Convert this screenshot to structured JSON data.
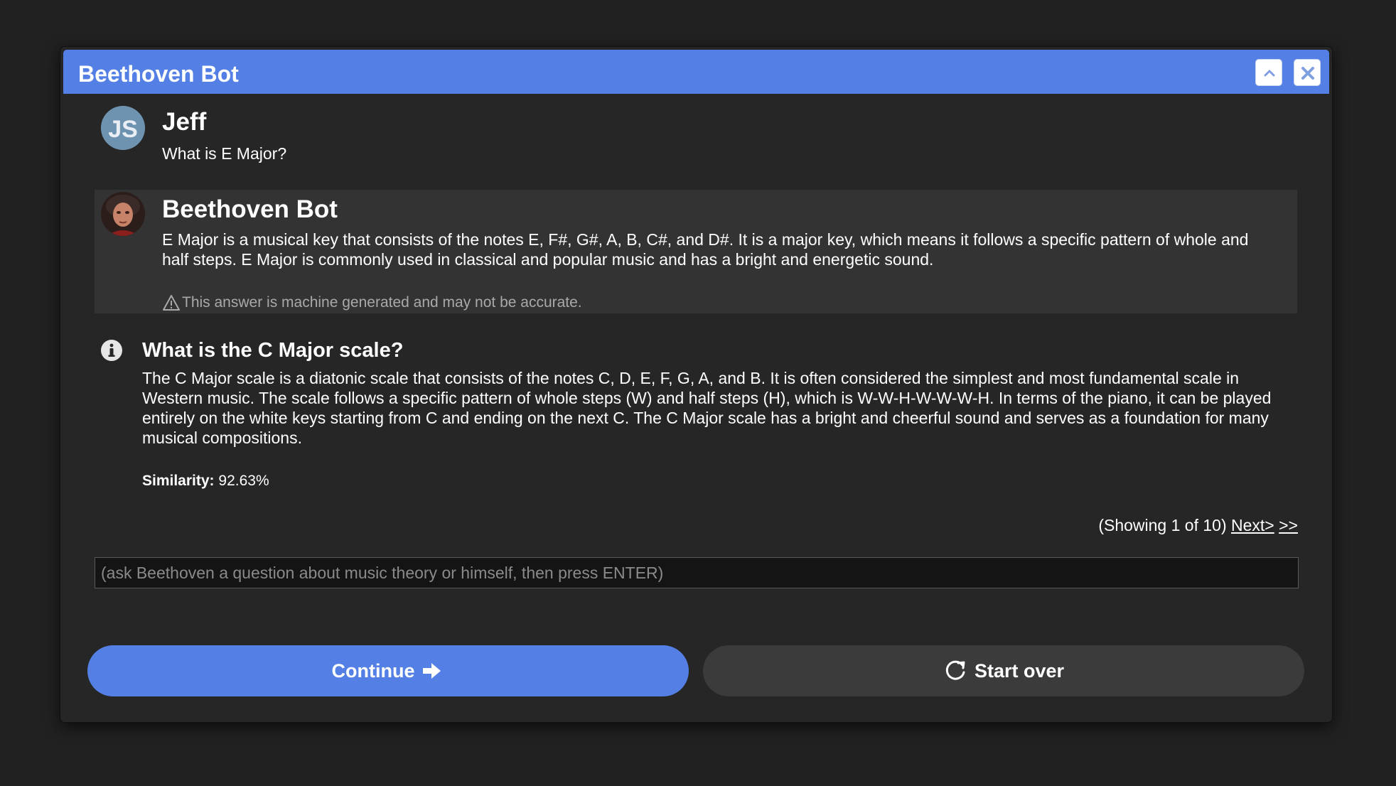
{
  "window": {
    "title": "Beethoven Bot"
  },
  "user_message": {
    "avatar_initials": "JS",
    "name": "Jeff",
    "text": "What is E Major?"
  },
  "bot_message": {
    "name": "Beethoven Bot",
    "text": "E Major is a musical key that consists of the notes E, F#, G#, A, B, C#, and D#. It is a major key, which means it follows a specific pattern of whole and half steps. E Major is commonly used in classical and popular music and has a bright and energetic sound.",
    "disclaimer": "This answer is machine generated and may not be accurate."
  },
  "related": {
    "title": "What is the C Major scale?",
    "answer": "The C Major scale is a diatonic scale that consists of the notes C, D, E, F, G, A, and B. It is often considered the simplest and most fundamental scale in Western music. The scale follows a specific pattern of whole steps (W) and half steps (H), which is W-W-H-W-W-W-H. In terms of the piano, it can be played entirely on the white keys starting from C and ending on the next C. The C Major scale has a bright and cheerful sound and serves as a foundation for many musical compositions.",
    "similarity_label": "Similarity:",
    "similarity_value": "92.63%"
  },
  "pager": {
    "status": "(Showing 1 of 10)",
    "next_label": "Next>",
    "last_label": ">>"
  },
  "input": {
    "placeholder": "(ask Beethoven a question about music theory or himself, then press ENTER)",
    "value": ""
  },
  "buttons": {
    "continue_label": "Continue",
    "start_over_label": "Start over"
  },
  "colors": {
    "accent": "#5480e6",
    "background": "#212121",
    "panel": "#262626",
    "bot_bubble": "#333333"
  },
  "icons": [
    "chevron-up-icon",
    "close-icon",
    "warning-icon",
    "info-icon",
    "arrow-right-icon",
    "refresh-icon"
  ]
}
